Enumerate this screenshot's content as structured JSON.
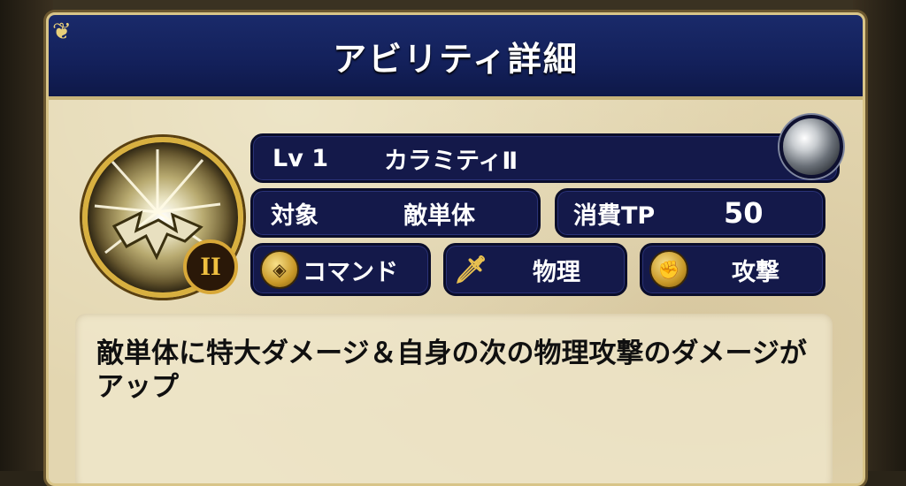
{
  "dialog": {
    "title": "アビリティ詳細"
  },
  "ability": {
    "level": "Lv 1",
    "name": "カラミティⅡ",
    "rank_mark": "II",
    "target_label": "対象",
    "target_value": "敵単体",
    "cost_label": "消費TP",
    "cost_value": "50",
    "tags": [
      {
        "label": "コマンド",
        "icon": "command-icon"
      },
      {
        "label": "物理",
        "icon": "sword-icon"
      },
      {
        "label": "攻撃",
        "icon": "fist-icon"
      }
    ],
    "description": "敵単体に特大ダメージ＆自身の次の物理攻撃のダメージがアップ"
  },
  "colors": {
    "header_bg": "#13205a",
    "panel_bg": "#14194a",
    "parchment": "#e3d6b0",
    "gold": "#d8b040"
  }
}
